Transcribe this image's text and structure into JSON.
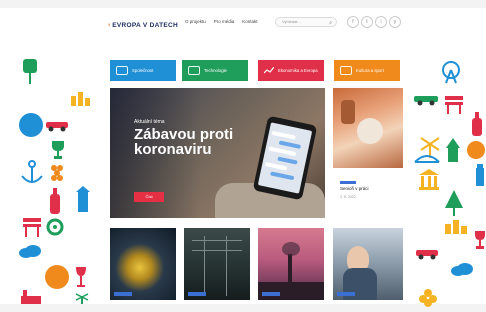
{
  "header": {
    "logo_text": "EVROPA V DATECH",
    "nav": [
      "O projektu",
      "Pro média",
      "Kontakt"
    ],
    "search_placeholder": "Vyhledat...",
    "social": [
      "f",
      "t",
      "i",
      "y"
    ]
  },
  "categories": [
    {
      "label": "Společnost",
      "color": "#1f8fd6"
    },
    {
      "label": "Technologie",
      "color": "#1e9e5a"
    },
    {
      "label": "Ekonomika a Evropa",
      "color": "#e02f48"
    },
    {
      "label": "Kultura a sport",
      "color": "#f08a1c"
    }
  ],
  "hero": {
    "kicker": "Aktuální téma",
    "title": "Zábavou proti koronaviru",
    "button": "Číst"
  },
  "side_article": {
    "title": "Senioři v práci",
    "meta": "3. 5. 2020"
  }
}
